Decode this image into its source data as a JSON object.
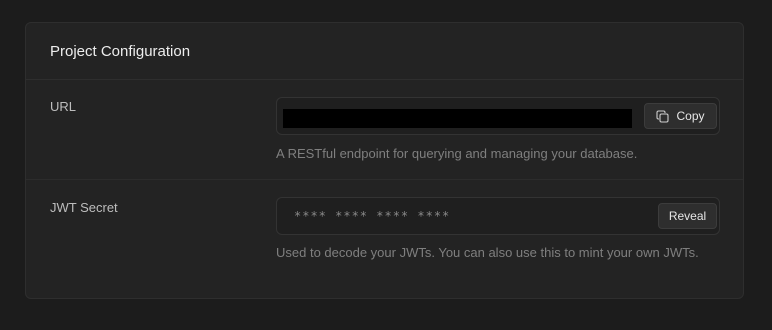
{
  "panel": {
    "title": "Project Configuration"
  },
  "url_row": {
    "label": "URL",
    "value_redacted": true,
    "copy_label": "Copy",
    "copy_icon": "copy-icon",
    "help": "A RESTful endpoint for querying and managing your database."
  },
  "jwt_row": {
    "label": "JWT Secret",
    "masked_value": "**** **** **** ****",
    "reveal_label": "Reveal",
    "help": "Used to decode your JWTs. You can also use this to mint your own JWTs."
  }
}
